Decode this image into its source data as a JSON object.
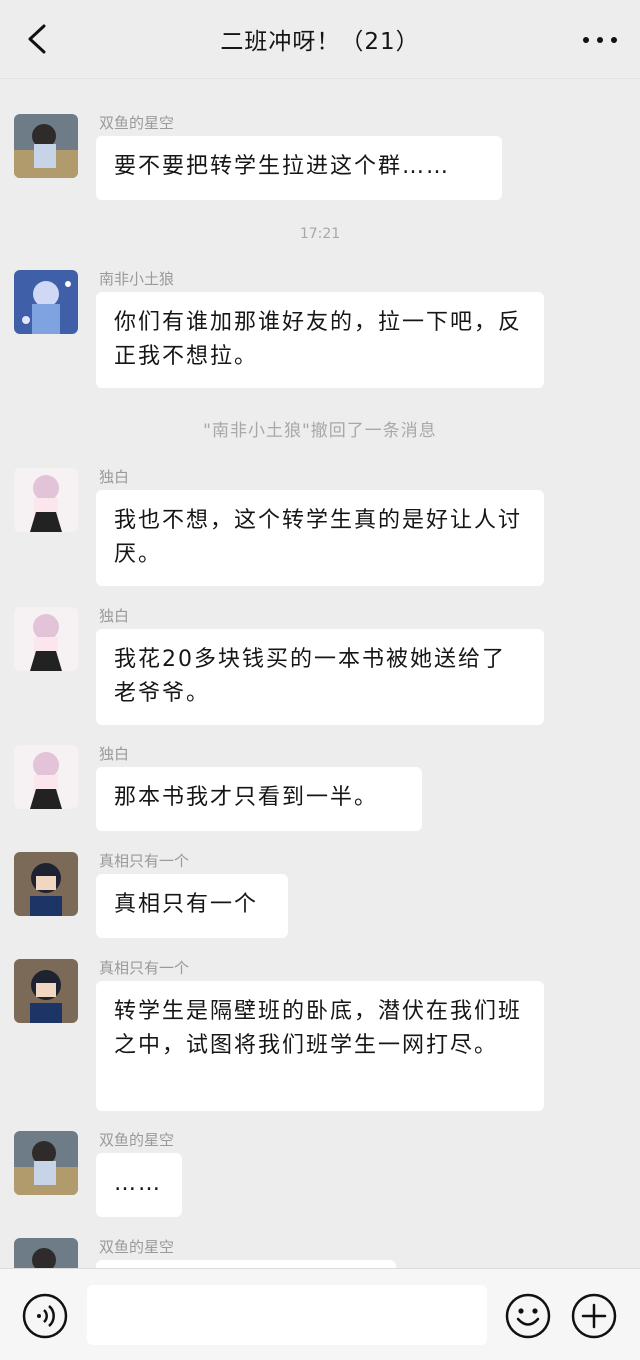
{
  "header": {
    "title": "二班冲呀！（21）"
  },
  "messages": [
    {
      "sender": "双鱼的星空",
      "text": "要不要把转学生拉进这个群……"
    },
    {
      "sender": "南非小土狼",
      "text": "你们有谁加那谁好友的，拉一下吧，反正我不想拉。"
    },
    {
      "sender": "独白",
      "text": "我也不想，这个转学生真的是好让人讨厌。"
    },
    {
      "sender": "独白",
      "text": "我花20多块钱买的一本书被她送给了老爷爷。"
    },
    {
      "sender": "独白",
      "text": "那本书我才只看到一半。"
    },
    {
      "sender": "真相只有一个",
      "text": "真相只有一个"
    },
    {
      "sender": "真相只有一个",
      "text": "转学生是隔壁班的卧底，潜伏在我们班之中，试图将我们班学生一网打尽。"
    },
    {
      "sender": "双鱼的星空",
      "text": "……"
    },
    {
      "sender": "双鱼的星空",
      "text": ""
    }
  ],
  "system": {
    "time": "17:21",
    "recall": "\"南非小土狼\"撤回了一条消息"
  },
  "input": {
    "value": "",
    "placeholder": ""
  },
  "icons": [
    "back-arrow-icon",
    "more-dots-icon",
    "voice-icon",
    "emoji-icon",
    "plus-icon"
  ]
}
